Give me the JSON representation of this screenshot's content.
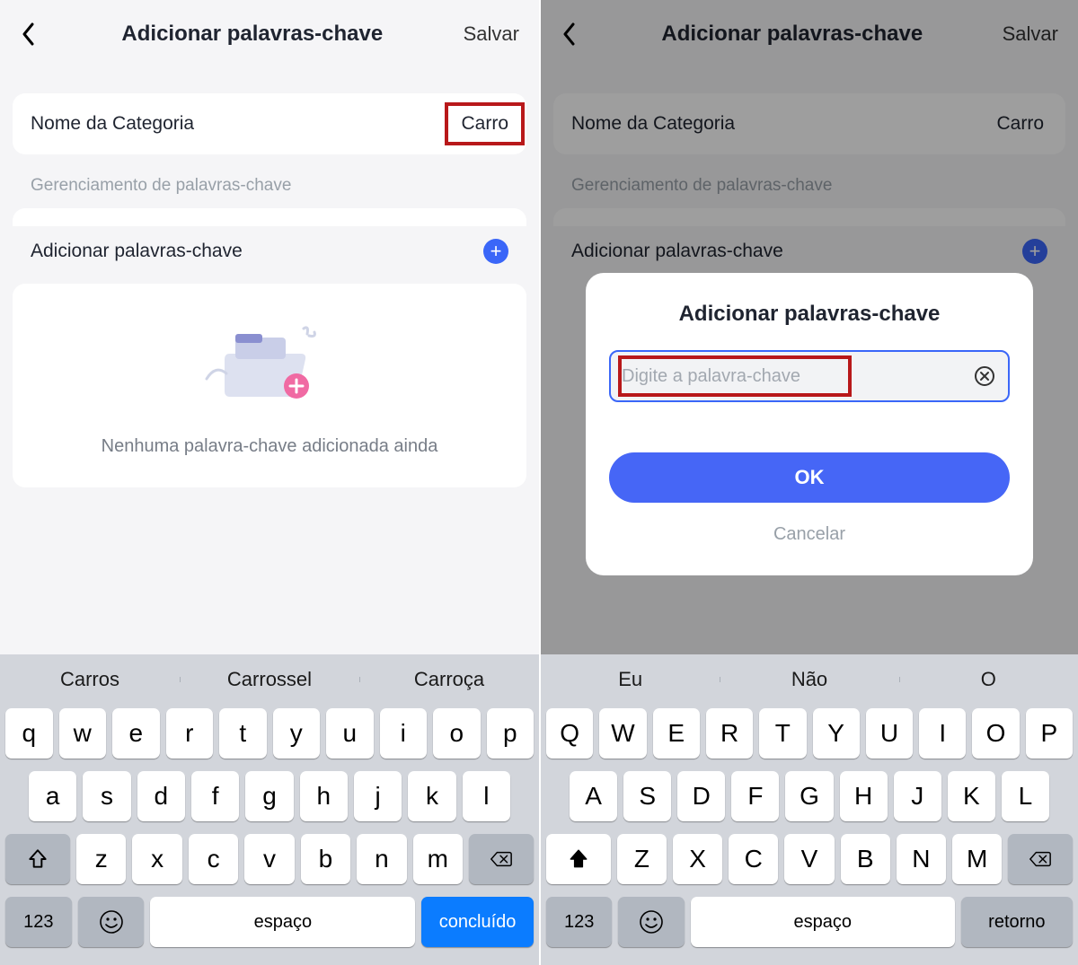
{
  "left": {
    "header": {
      "title": "Adicionar palavras-chave",
      "save": "Salvar"
    },
    "category": {
      "label": "Nome da Categoria",
      "value": "Carro"
    },
    "section_label": "Gerenciamento de palavras-chave",
    "add_row": "Adicionar palavras-chave",
    "empty_text": "Nenhuma palavra-chave adicionada ainda",
    "keyboard": {
      "suggestions": [
        "Carros",
        "Carrossel",
        "Carroça"
      ],
      "row1": [
        "q",
        "w",
        "e",
        "r",
        "t",
        "y",
        "u",
        "i",
        "o",
        "p"
      ],
      "row2": [
        "a",
        "s",
        "d",
        "f",
        "g",
        "h",
        "j",
        "k",
        "l"
      ],
      "row3": [
        "z",
        "x",
        "c",
        "v",
        "b",
        "n",
        "m"
      ],
      "num": "123",
      "space": "espaço",
      "action": "concluído"
    }
  },
  "right": {
    "header": {
      "title": "Adicionar palavras-chave",
      "save": "Salvar"
    },
    "category": {
      "label": "Nome da Categoria",
      "value": "Carro"
    },
    "section_label": "Gerenciamento de palavras-chave",
    "add_row": "Adicionar palavras-chave",
    "modal": {
      "title": "Adicionar palavras-chave",
      "placeholder": "Digite a palavra-chave",
      "ok": "OK",
      "cancel": "Cancelar"
    },
    "keyboard": {
      "suggestions": [
        "Eu",
        "Não",
        "O"
      ],
      "row1": [
        "Q",
        "W",
        "E",
        "R",
        "T",
        "Y",
        "U",
        "I",
        "O",
        "P"
      ],
      "row2": [
        "A",
        "S",
        "D",
        "F",
        "G",
        "H",
        "J",
        "K",
        "L"
      ],
      "row3": [
        "Z",
        "X",
        "C",
        "V",
        "B",
        "N",
        "M"
      ],
      "num": "123",
      "space": "espaço",
      "action": "retorno"
    }
  }
}
